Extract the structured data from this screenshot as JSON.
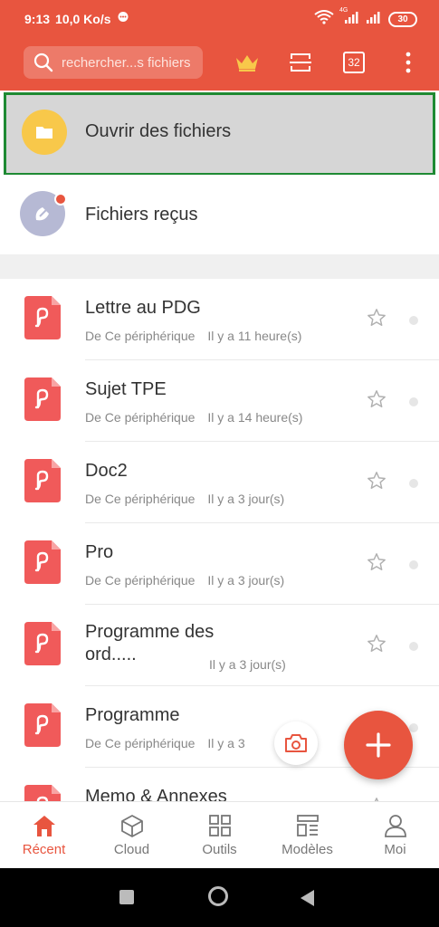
{
  "status_bar": {
    "time": "9:13",
    "speed": "10,0 Ko/s",
    "network": "4G",
    "battery": "30"
  },
  "top_bar": {
    "search_placeholder": "rechercher...s fichiers",
    "calendar_day": "32"
  },
  "open_files": {
    "label": "Ouvrir des fichiers"
  },
  "received_files": {
    "label": "Fichiers reçus"
  },
  "files": [
    {
      "name": "Lettre au PDG",
      "source": "De Ce périphérique",
      "time": "Il y a 11 heure(s)"
    },
    {
      "name": "Sujet TPE",
      "source": "De Ce périphérique",
      "time": "Il y a 14 heure(s)"
    },
    {
      "name": "Doc2",
      "source": "De Ce périphérique",
      "time": "Il y a 3 jour(s)"
    },
    {
      "name": "Pro",
      "source": "De Ce périphérique",
      "time": "Il y a 3 jour(s)"
    },
    {
      "name": "Programme des ord.....",
      "source": "",
      "time": "Il y a 3 jour(s)"
    },
    {
      "name": "Programme",
      "source": "De Ce périphérique",
      "time": "Il y a 3"
    },
    {
      "name": "Memo & Annexes",
      "source": "",
      "time": ""
    }
  ],
  "bottom_nav": [
    {
      "label": "Récent",
      "active": true
    },
    {
      "label": "Cloud"
    },
    {
      "label": "Outils"
    },
    {
      "label": "Modèles"
    },
    {
      "label": "Moi"
    }
  ],
  "colors": {
    "brand": "#e8553f",
    "selection_border": "#1e8a33",
    "folder": "#f8c84a"
  }
}
